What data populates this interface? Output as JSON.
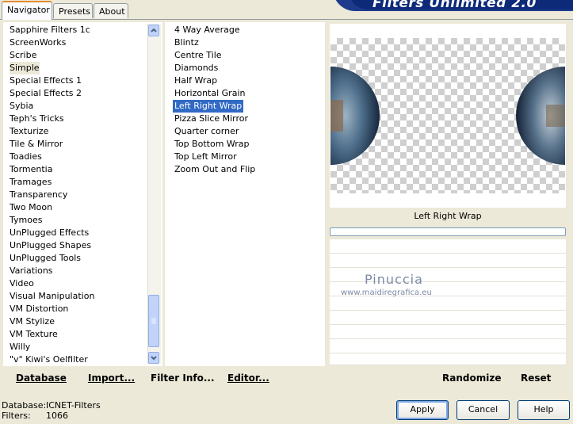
{
  "tabs": [
    "Navigator",
    "Presets",
    "About"
  ],
  "banner_title": "Filters Unlimited 2.0",
  "categories": [
    "Sapphire Filters 1c",
    "ScreenWorks",
    "Scribe",
    "Simple",
    "Special Effects 1",
    "Special Effects 2",
    "Sybia",
    "Teph's Tricks",
    "Texturize",
    "Tile & Mirror",
    "Toadies",
    "Tormentia",
    "Tramages",
    "Transparency",
    "Two Moon",
    "Tymoes",
    "UnPlugged Effects",
    "UnPlugged Shapes",
    "UnPlugged Tools",
    "Variations",
    "Video",
    "Visual Manipulation",
    "VM Distortion",
    "VM Stylize",
    "VM Texture",
    "Willy",
    "\"v\" Kiwi's Oelfilter"
  ],
  "selected_category": "Simple",
  "filters": [
    "4 Way Average",
    "Blintz",
    "Centre Tile",
    "Diamonds",
    "Half Wrap",
    "Horizontal Grain",
    "Left Right Wrap",
    "Pizza Slice Mirror",
    "Quarter corner",
    "Top Bottom Wrap",
    "Top Left Mirror",
    "Zoom Out and Flip"
  ],
  "selected_filter": "Left Right Wrap",
  "preview_filter_name": "Left Right Wrap",
  "watermark": {
    "name": "Pinuccia",
    "url": "www.maidiregrafica.eu"
  },
  "left_actions": {
    "database": "Database",
    "import": "Import...",
    "filter_info": "Filter Info...",
    "editor": "Editor..."
  },
  "right_actions": {
    "randomize": "Randomize",
    "reset": "Reset"
  },
  "status": {
    "database_label": "Database:",
    "database_value": "ICNET-Filters",
    "filters_label": "Filters:",
    "filters_value": "1066"
  },
  "buttons": {
    "apply": "Apply",
    "cancel": "Cancel",
    "help": "Help"
  },
  "icons": {
    "scroll_up": "chevron-up-icon",
    "scroll_down": "chevron-down-icon"
  }
}
